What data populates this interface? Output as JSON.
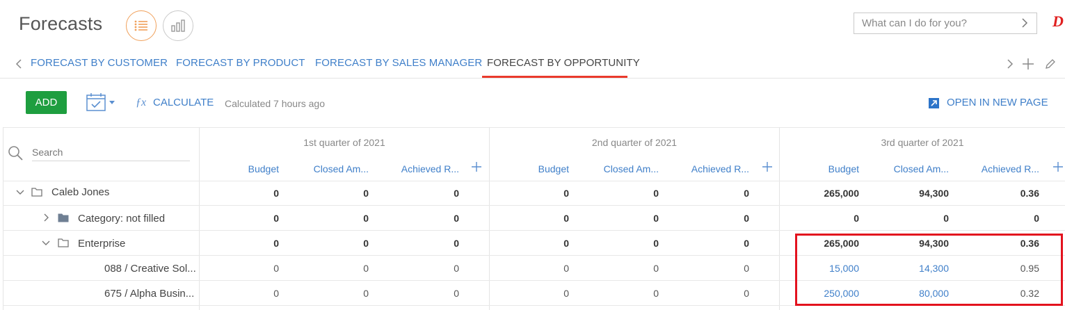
{
  "header": {
    "title": "Forecasts",
    "command_placeholder": "What can I do for you?",
    "logo_fragment": "D"
  },
  "tabs": [
    {
      "label": "FORECAST BY CUSTOMER",
      "active": false
    },
    {
      "label": "FORECAST BY PRODUCT",
      "active": false
    },
    {
      "label": "FORECAST BY SALES MANAGER",
      "active": false
    },
    {
      "label": "FORECAST BY OPPORTUNITY",
      "active": true
    }
  ],
  "toolbar": {
    "add_label": "ADD",
    "calculate_label": "CALCULATE",
    "calculated_text": "Calculated 7 hours ago",
    "open_new_page_label": "OPEN IN NEW PAGE"
  },
  "grid": {
    "search_placeholder": "Search",
    "quarters": [
      {
        "title": "1st quarter of 2021",
        "columns": [
          "Budget",
          "Closed Am...",
          "Achieved R..."
        ]
      },
      {
        "title": "2nd quarter of 2021",
        "columns": [
          "Budget",
          "Closed Am...",
          "Achieved R..."
        ]
      },
      {
        "title": "3rd quarter of 2021",
        "columns": [
          "Budget",
          "Closed Am...",
          "Achieved R..."
        ]
      }
    ],
    "rows": [
      {
        "label": "Caleb Jones",
        "level": 0,
        "expander": "expanded",
        "icon": "folder-open-icon",
        "style": "bold",
        "values": [
          "0",
          "0",
          "0",
          "0",
          "0",
          "0",
          "265,000",
          "94,300",
          "0.36"
        ]
      },
      {
        "label": "Category: not filled",
        "level": 1,
        "expander": "collapsed",
        "icon": "folder-filled-icon",
        "style": "bold",
        "values": [
          "0",
          "0",
          "0",
          "0",
          "0",
          "0",
          "0",
          "0",
          "0"
        ]
      },
      {
        "label": "Enterprise",
        "level": 1,
        "expander": "expanded",
        "icon": "folder-open-icon",
        "style": "bold",
        "values": [
          "0",
          "0",
          "0",
          "0",
          "0",
          "0",
          "265,000",
          "94,300",
          "0.36"
        ]
      },
      {
        "label": "088 / Creative Sol...",
        "level": 2,
        "expander": "none",
        "icon": "",
        "style": "light",
        "values": [
          "0",
          "0",
          "0",
          "0",
          "0",
          "0",
          "15,000",
          "14,300",
          "0.95"
        ],
        "link_cols": [
          6,
          7
        ]
      },
      {
        "label": "675 / Alpha Busin...",
        "level": 2,
        "expander": "none",
        "icon": "",
        "style": "light",
        "values": [
          "0",
          "0",
          "0",
          "0",
          "0",
          "0",
          "250,000",
          "80,000",
          "0.32"
        ],
        "link_cols": [
          6,
          7
        ]
      }
    ]
  },
  "colors": {
    "accent_blue": "#3f7fc9",
    "add_green": "#1e9e3f",
    "tab_underline_red": "#ea3a2c",
    "highlight_red": "#e3121e",
    "active_view_orange": "#f0a05a"
  }
}
